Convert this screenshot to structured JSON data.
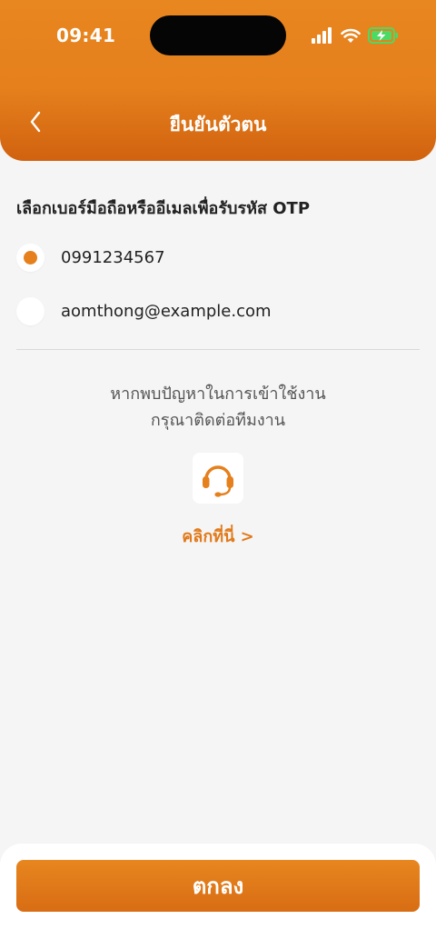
{
  "status_bar": {
    "time": "09:41"
  },
  "header": {
    "title": "ยืนยันตัวตน"
  },
  "otp": {
    "section_title": "เลือกเบอร์มือถือหรืออีเมลเพื่อรับรหัส OTP",
    "options": [
      {
        "label": "0991234567",
        "selected": true
      },
      {
        "label": "aomthong@example.com",
        "selected": false
      }
    ]
  },
  "help": {
    "line1": "หากพบปัญหาในการเข้าใช้งาน",
    "line2": "กรุณาติดต่อทีมงาน",
    "icon": "headset-icon",
    "link_label": "คลิกที่นี่ >"
  },
  "footer": {
    "confirm_label": "ตกลง"
  },
  "colors": {
    "accent": "#e5801d",
    "accent_dark": "#d1620f",
    "background": "#f5f5f5",
    "text": "#222222",
    "battery_green": "#4cd964"
  }
}
